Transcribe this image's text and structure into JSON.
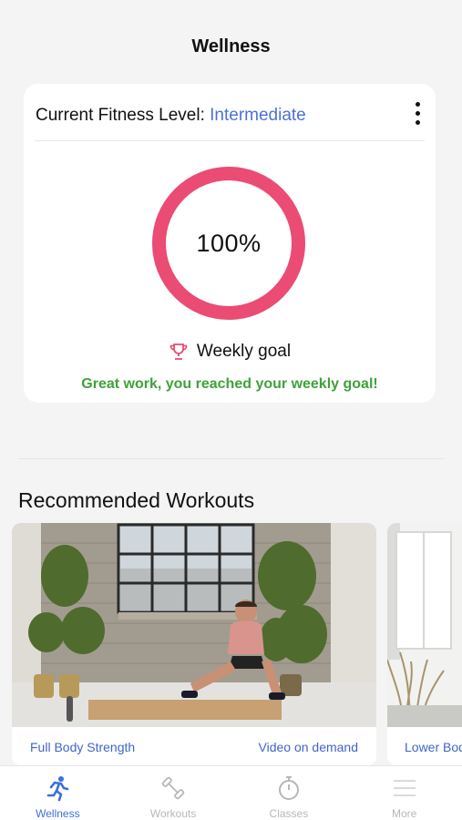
{
  "header": {
    "title": "Wellness"
  },
  "fitness_card": {
    "level_label": "Current Fitness Level:",
    "level_value": "Intermediate",
    "progress_text": "100%",
    "progress_fraction": 1.0,
    "goal_label": "Weekly goal",
    "goal_message": "Great work, you reached your weekly goal!"
  },
  "recommended": {
    "title": "Recommended Workouts",
    "workouts": [
      {
        "title": "Full Body Strength",
        "type": "Video on demand"
      },
      {
        "title": "Lower Body",
        "type": ""
      }
    ]
  },
  "tabbar": {
    "tabs": [
      {
        "label": "Wellness",
        "icon": "running-person-icon",
        "active": true
      },
      {
        "label": "Workouts",
        "icon": "dumbbell-icon",
        "active": false
      },
      {
        "label": "Classes",
        "icon": "stopwatch-icon",
        "active": false
      },
      {
        "label": "More",
        "icon": "menu-icon",
        "active": false
      }
    ]
  },
  "colors": {
    "accent_blue": "#4a72d6",
    "ring_pink": "#ea4c74",
    "success_green": "#3ea23a",
    "inactive_gray": "#b7b7b7"
  }
}
